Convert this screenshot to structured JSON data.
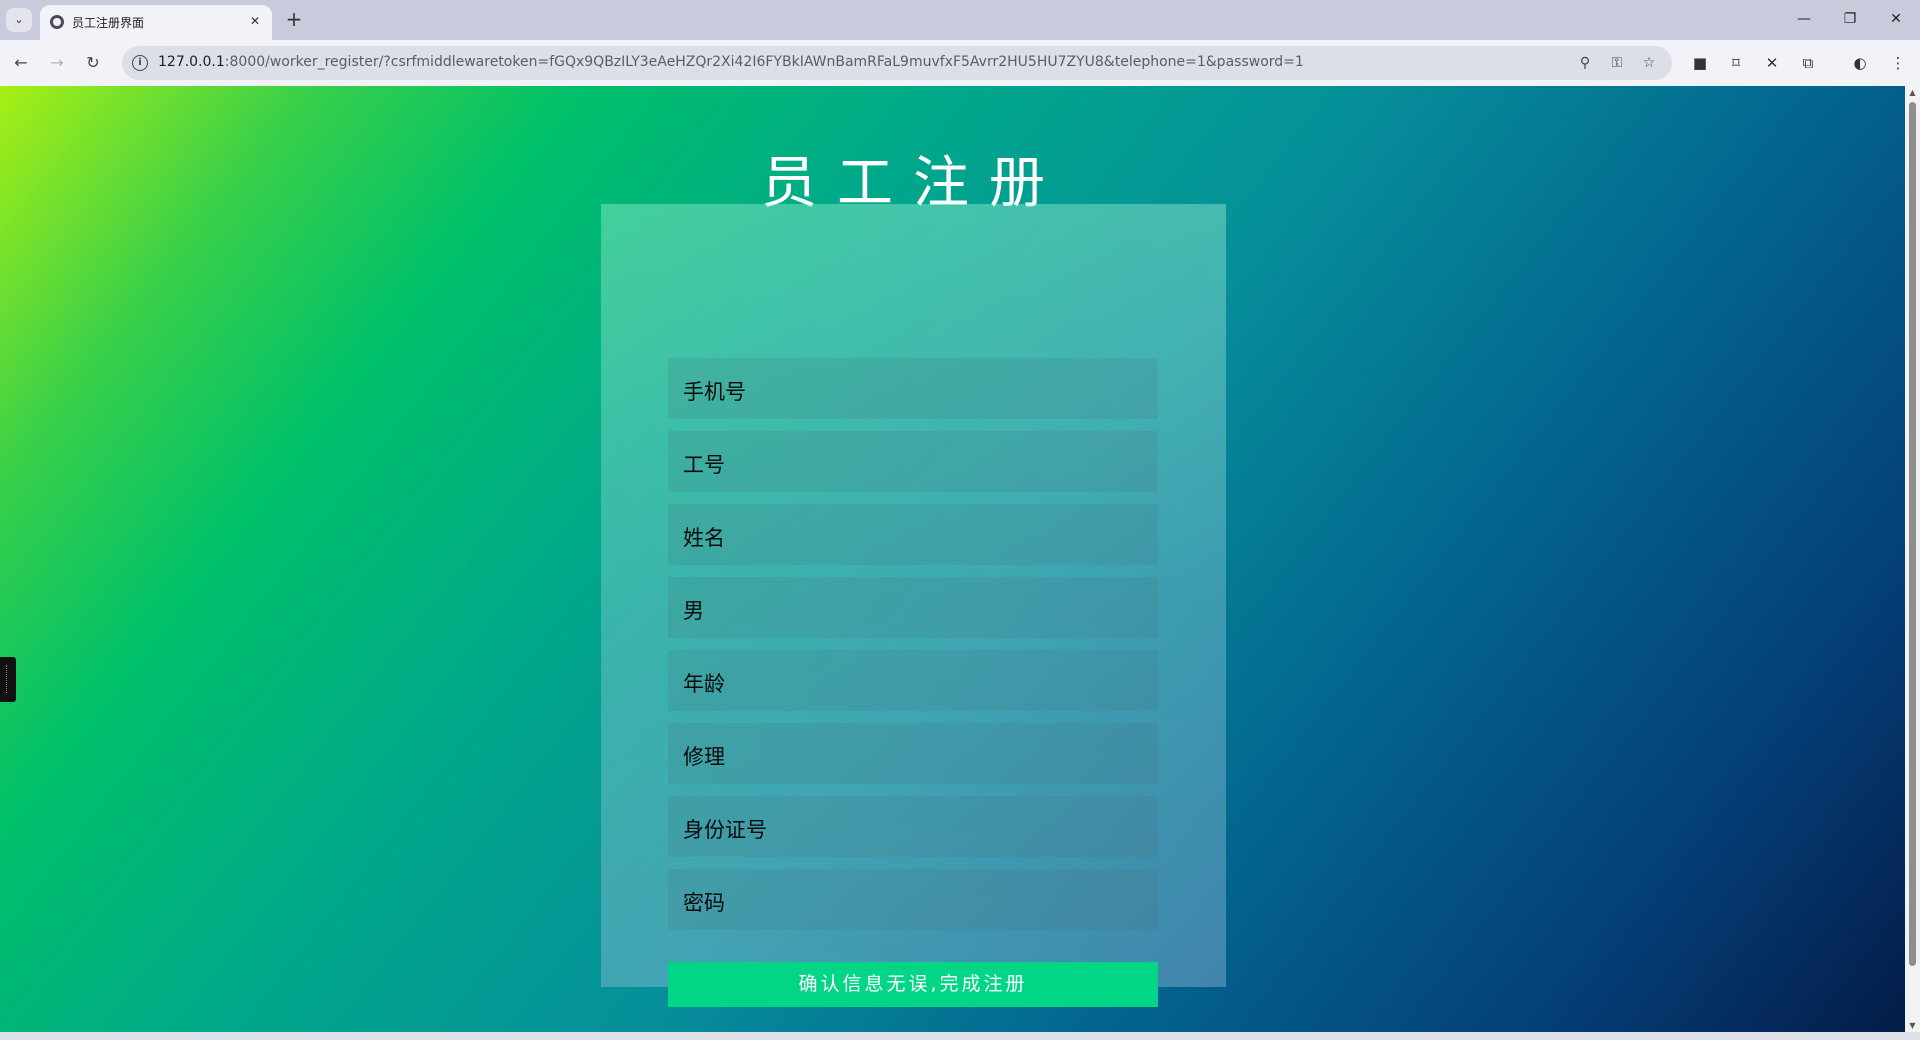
{
  "browser": {
    "tab_title": "员工注册界面",
    "url_host": "127.0.0.1",
    "url_path": ":8000/worker_register/?csrfmiddlewaretoken=fGQx9QBzILY3eAeHZQr2Xi42I6FYBkIAWnBamRFaL9muvfxF5Avrr2HU5HU7ZYU8&telephone=1&password=1",
    "tab_close": "✕",
    "new_tab": "+",
    "tab_menu": "⌄",
    "window_minimize": "—",
    "window_restore": "❐",
    "window_close": "✕"
  },
  "nav": {
    "back": "←",
    "forward": "→",
    "reload": "↻"
  },
  "toolbar_icons": {
    "zoom": "⚲",
    "key": "⚿",
    "star": "☆",
    "reader": "■",
    "bookmark": "⌑",
    "close_ext": "✕",
    "extensions": "⧉",
    "profile": "◐",
    "menu": "⋮"
  },
  "page": {
    "heading": "员工注册",
    "fields": [
      "手机号",
      "工号",
      "姓名",
      "男",
      "年龄",
      "修理",
      "身份证号",
      "密码"
    ],
    "submit_label": "确认信息无误,完成注册"
  },
  "colors": {
    "submit_bg": "#00d685"
  }
}
